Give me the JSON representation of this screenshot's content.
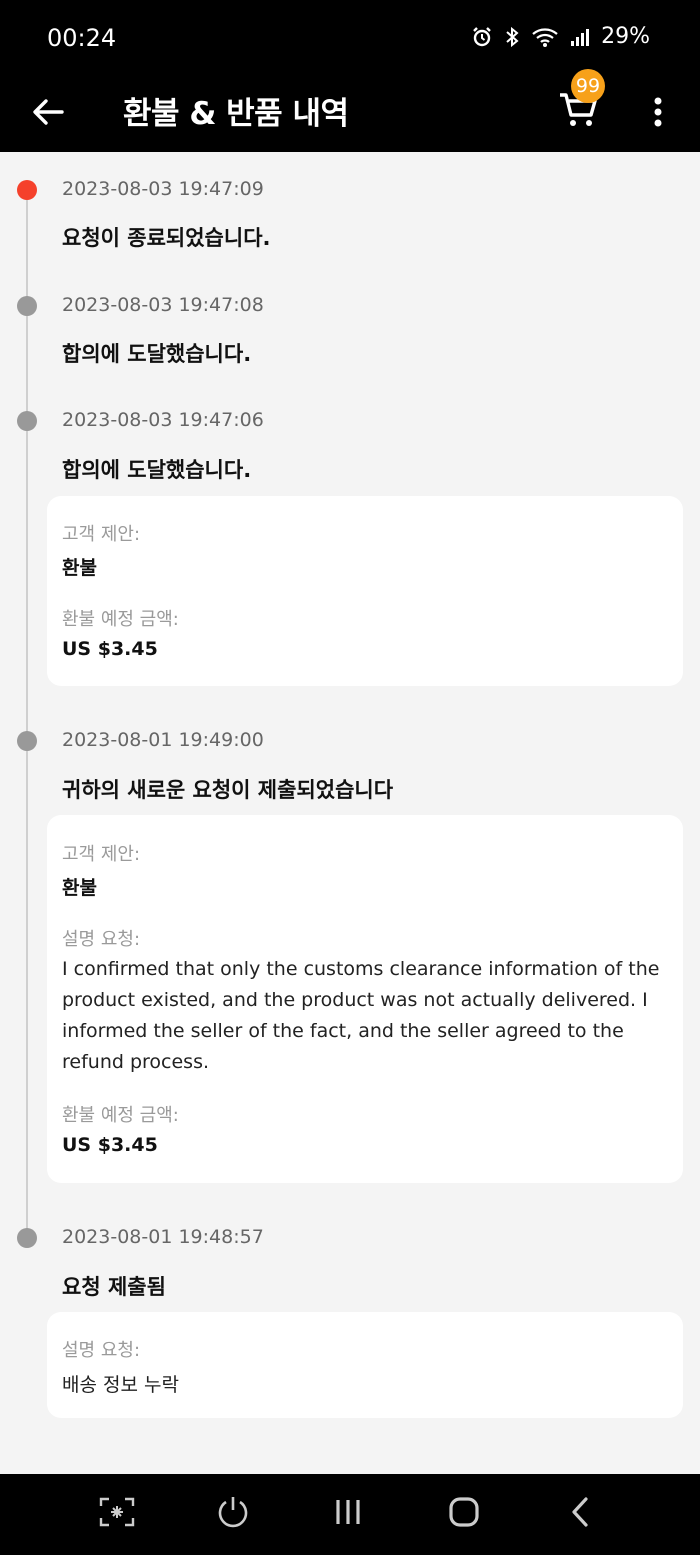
{
  "status_bar": {
    "time": "00:24",
    "battery": "29%"
  },
  "app_bar": {
    "title": "환불 & 반품 내역",
    "cart_badge": "99"
  },
  "events": [
    {
      "timestamp": "2023-08-03 19:47:09",
      "title": "요청이 종료되었습니다."
    },
    {
      "timestamp": "2023-08-03 19:47:08",
      "title": "합의에 도달했습니다."
    },
    {
      "timestamp": "2023-08-03 19:47:06",
      "title": "합의에 도달했습니다.",
      "card": {
        "proposal_label": "고객 제안:",
        "proposal_value": "환불",
        "amount_label": "환불 예정 금액:",
        "amount_value": "US $3.45"
      }
    },
    {
      "timestamp": "2023-08-01 19:49:00",
      "title": "귀하의 새로운 요청이 제출되었습니다",
      "card": {
        "proposal_label": "고객 제안:",
        "proposal_value": "환불",
        "desc_label": "설명 요청:",
        "desc_value": "I confirmed that only the customs clearance information of the product existed, and the product was not actually delivered. I informed the seller of the fact, and the seller agreed to the refund process.",
        "amount_label": "환불 예정 금액:",
        "amount_value": "US $3.45"
      }
    },
    {
      "timestamp": "2023-08-01 19:48:57",
      "title": "요청 제출됨",
      "card": {
        "desc_label": "설명 요청:",
        "desc_value": "배송 정보 누락"
      }
    }
  ],
  "colors": {
    "active_dot": "#f5412b",
    "inactive_dot": "#999999",
    "badge": "#f7a11a"
  }
}
